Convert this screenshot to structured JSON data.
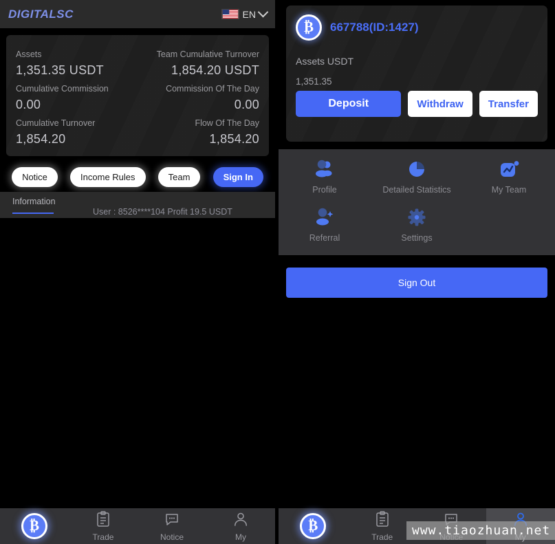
{
  "left_panel": {
    "header": {
      "logo": "DIGITALSC",
      "language": "EN",
      "flag_icon": "us-flag-icon",
      "chevron_icon": "chevron-down-icon"
    },
    "stats": [
      {
        "label": "Assets",
        "value": "1,351.35 USDT"
      },
      {
        "label": "Team Cumulative Turnover",
        "value": "1,854.20 USDT"
      },
      {
        "label": "Cumulative Commission",
        "value": "0.00"
      },
      {
        "label": "Commission Of The Day",
        "value": "0.00"
      },
      {
        "label": "Cumulative Turnover",
        "value": "1,854.20"
      },
      {
        "label": "Flow Of The Day",
        "value": "1,854.20"
      }
    ],
    "pills": [
      {
        "label": "Notice",
        "style": "white"
      },
      {
        "label": "Income Rules",
        "style": "white"
      },
      {
        "label": "Team",
        "style": "white"
      },
      {
        "label": "Sign In",
        "style": "primary"
      }
    ],
    "info": {
      "tab_label": "Information",
      "ticker": "User : 8526****104 Profit 19.5 USDT"
    },
    "bottom_nav": [
      {
        "label": "",
        "icon": "bitcoin-icon",
        "active": false
      },
      {
        "label": "Trade",
        "icon": "clipboard-icon",
        "active": false
      },
      {
        "label": "Notice",
        "icon": "chat-icon",
        "active": false
      },
      {
        "label": "My",
        "icon": "person-icon",
        "active": false
      }
    ]
  },
  "right_panel": {
    "account": {
      "avatar_icon": "bitcoin-icon",
      "name": "667788(ID:1427)",
      "assets_label": "Assets USDT",
      "assets_value": "1,351.35",
      "deposit_label": "Deposit",
      "withdraw_label": "Withdraw",
      "transfer_label": "Transfer"
    },
    "quick_actions": [
      {
        "label": "Profile",
        "icon": "people-icon"
      },
      {
        "label": "Detailed Statistics",
        "icon": "pie-chart-icon"
      },
      {
        "label": "My Team",
        "icon": "trend-chart-icon"
      },
      {
        "label": "Referral",
        "icon": "person-add-icon"
      },
      {
        "label": "Settings",
        "icon": "gear-icon"
      }
    ],
    "sign_out_label": "Sign Out",
    "bottom_nav": [
      {
        "label": "",
        "icon": "bitcoin-icon",
        "active": false
      },
      {
        "label": "Trade",
        "icon": "clipboard-icon",
        "active": false
      },
      {
        "label": "Notice",
        "icon": "chat-icon",
        "active": false
      },
      {
        "label": "My",
        "icon": "person-icon",
        "active": true
      }
    ]
  },
  "watermark": "www.tiaozhuan.net",
  "colors": {
    "accent_blue": "#4668f5",
    "logo_blue": "#7e90e8",
    "card_bg": "#1f1f1f",
    "panel_bg": "#000000",
    "nav_bg": "#333336"
  }
}
